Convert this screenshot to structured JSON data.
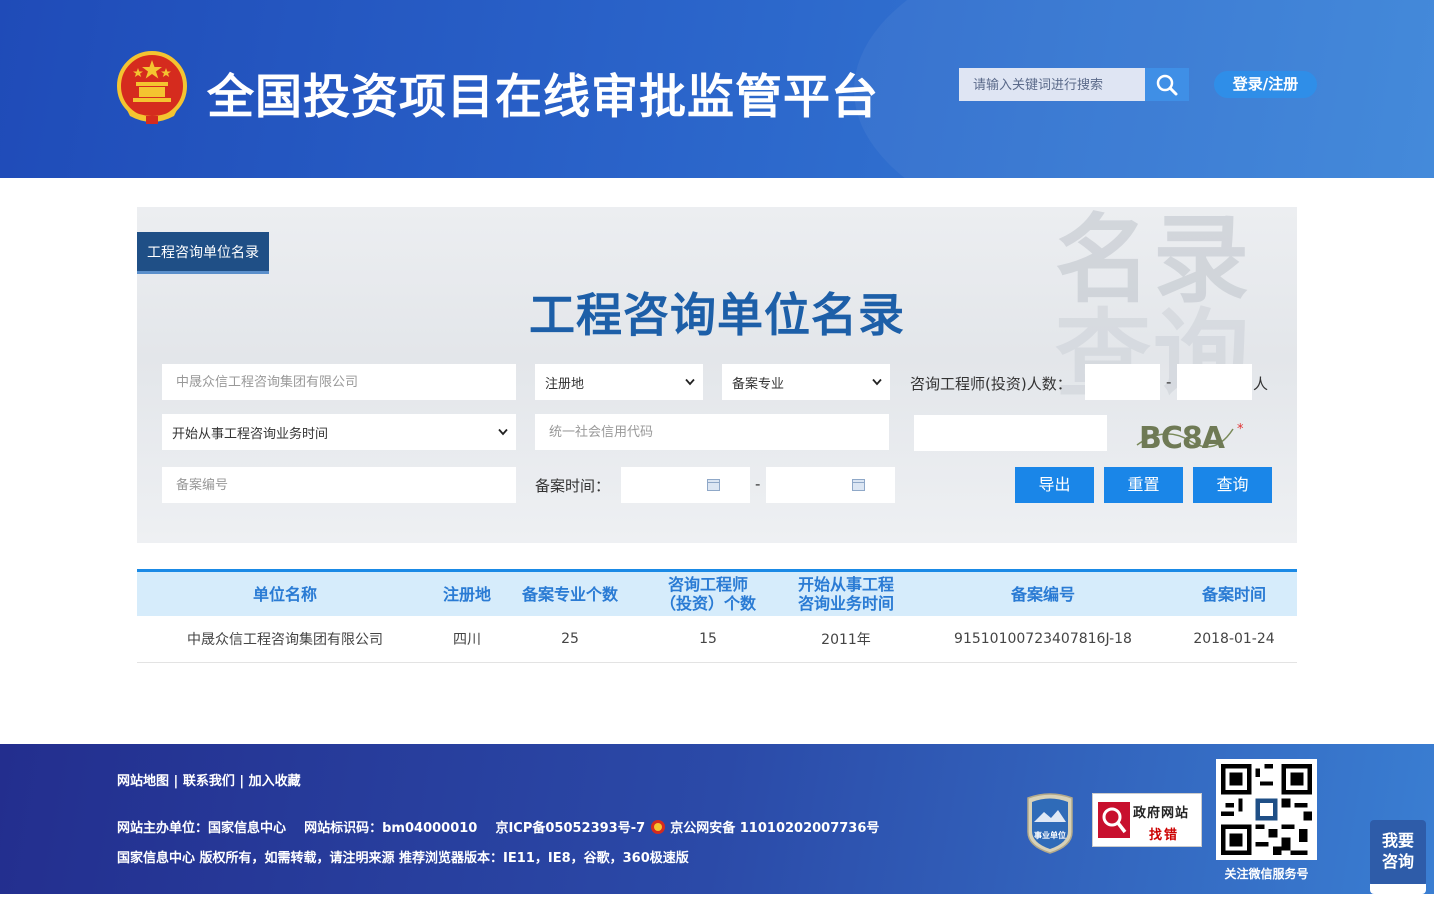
{
  "header": {
    "site_title": "全国投资项目在线审批监管平台",
    "search_placeholder": "请输入关键词进行搜索",
    "search_icon": "search-icon",
    "login_label": "登录/注册",
    "brand_color": "#2a63c9"
  },
  "panel": {
    "tab_label": "工程咨询单位名录",
    "title": "工程咨询单位名录",
    "watermark_line1": "名录",
    "watermark_line2": "查询",
    "company_input_placeholder": "中晟众信工程咨询集团有限公司",
    "region_select": "注册地",
    "specialty_select": "备案专业",
    "engineer_count_label": "咨询工程师(投资)人数：",
    "range_separator": "-",
    "person_unit": "人",
    "start_time_select": "开始从事工程咨询业务时间",
    "credit_code_placeholder": "统一社会信用代码",
    "captcha_text": "BC8A",
    "required_mark": "*",
    "record_no_placeholder": "备案编号",
    "record_time_label": "备案时间：",
    "export_label": "导出",
    "reset_label": "重置",
    "query_label": "查询",
    "button_color": "#1a86e8"
  },
  "table": {
    "headers": {
      "name": "单位名称",
      "region": "注册地",
      "specialty_count": "备案专业个数",
      "engineer_line1": "咨询工程师",
      "engineer_line2": "（投资）个数",
      "start_line1": "开始从事工程",
      "start_line2": "咨询业务时间",
      "record_no": "备案编号",
      "record_time": "备案时间"
    },
    "rows": [
      {
        "name": "中晟众信工程咨询集团有限公司",
        "region": "四川",
        "specialty_count": "25",
        "engineer_count": "15",
        "start_year": "2011年",
        "record_no": "91510100723407816J-18",
        "record_time": "2018-01-24"
      }
    ]
  },
  "footer": {
    "link_sitemap": "网站地图",
    "link_contact": "联系我们",
    "link_favorite": "加入收藏",
    "link_sep": "|",
    "line1_sponsor": "网站主办单位：国家信息中心",
    "line1_id": "网站标识码：bm04000010",
    "line1_icp": "京ICP备05052393号-7",
    "line1_police": "京公网安备 11010202007736号",
    "line2": "国家信息中心 版权所有，如需转载，请注明来源    推荐浏览器版本：IE11，IE8，谷歌，360极速版",
    "badge_shiye": "事业单位",
    "gov_badge_top": "政府网站",
    "gov_badge_bottom": "找错",
    "qr_caption": "关注微信服务号",
    "consult_line1": "我要",
    "consult_line2": "咨询"
  }
}
